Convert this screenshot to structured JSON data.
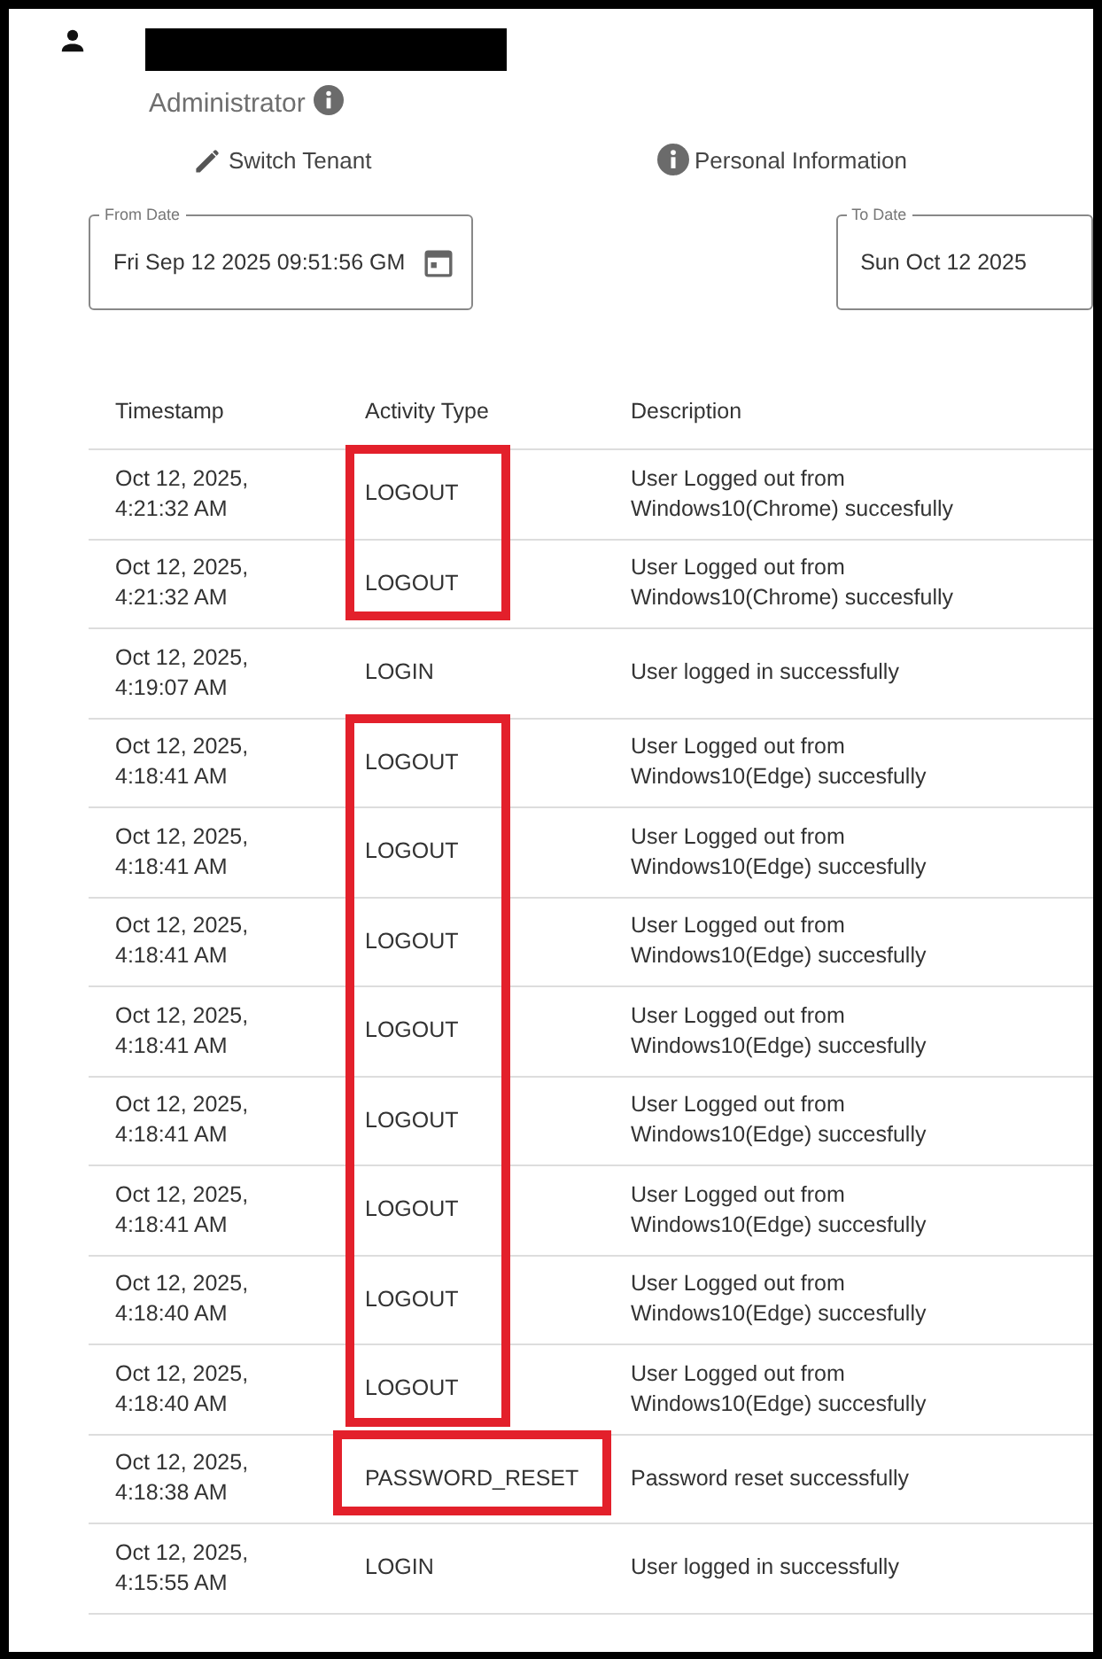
{
  "profile": {
    "role": "Administrator",
    "actions": [
      {
        "kind": "edit",
        "label": "Switch Tenant"
      },
      {
        "kind": "info",
        "label": "Personal Information"
      }
    ]
  },
  "filters": [
    {
      "label": "From Date",
      "value": "Fri Sep 12 2025 09:51:56 GM"
    },
    {
      "label": "To Date",
      "value": "Sun Oct 12 2025"
    }
  ],
  "table": {
    "columns": [
      "Timestamp",
      "Activity Type",
      "Description"
    ],
    "rows": [
      {
        "timestamp": "Oct 12, 2025, 4:21:32 AM",
        "activity": "LOGOUT",
        "description": "User Logged out from Windows10(Chrome) succesfully",
        "highlighted": true
      },
      {
        "timestamp": "Oct 12, 2025, 4:21:32 AM",
        "activity": "LOGOUT",
        "description": "User Logged out from Windows10(Chrome) succesfully",
        "highlighted": true
      },
      {
        "timestamp": "Oct 12, 2025, 4:19:07 AM",
        "activity": "LOGIN",
        "description": "User logged in successfully",
        "highlighted": false
      },
      {
        "timestamp": "Oct 12, 2025, 4:18:41 AM",
        "activity": "LOGOUT",
        "description": "User Logged out from Windows10(Edge) succesfully",
        "highlighted": true
      },
      {
        "timestamp": "Oct 12, 2025, 4:18:41 AM",
        "activity": "LOGOUT",
        "description": "User Logged out from Windows10(Edge) succesfully",
        "highlighted": true
      },
      {
        "timestamp": "Oct 12, 2025, 4:18:41 AM",
        "activity": "LOGOUT",
        "description": "User Logged out from Windows10(Edge) succesfully",
        "highlighted": true
      },
      {
        "timestamp": "Oct 12, 2025, 4:18:41 AM",
        "activity": "LOGOUT",
        "description": "User Logged out from Windows10(Edge) succesfully",
        "highlighted": true
      },
      {
        "timestamp": "Oct 12, 2025, 4:18:41 AM",
        "activity": "LOGOUT",
        "description": "User Logged out from Windows10(Edge) succesfully",
        "highlighted": true
      },
      {
        "timestamp": "Oct 12, 2025, 4:18:41 AM",
        "activity": "LOGOUT",
        "description": "User Logged out from Windows10(Edge) succesfully",
        "highlighted": true
      },
      {
        "timestamp": "Oct 12, 2025, 4:18:40 AM",
        "activity": "LOGOUT",
        "description": "User Logged out from Windows10(Edge) succesfully",
        "highlighted": true
      },
      {
        "timestamp": "Oct 12, 2025, 4:18:40 AM",
        "activity": "LOGOUT",
        "description": "User Logged out from Windows10(Edge) succesfully",
        "highlighted": true
      },
      {
        "timestamp": "Oct 12, 2025, 4:18:38 AM",
        "activity": "PASSWORD_RESET",
        "description": "Password reset successfully",
        "highlighted": true,
        "wide": true
      },
      {
        "timestamp": "Oct 12, 2025, 4:15:55 AM",
        "activity": "LOGIN",
        "description": "User logged in successfully",
        "highlighted": false
      }
    ]
  }
}
